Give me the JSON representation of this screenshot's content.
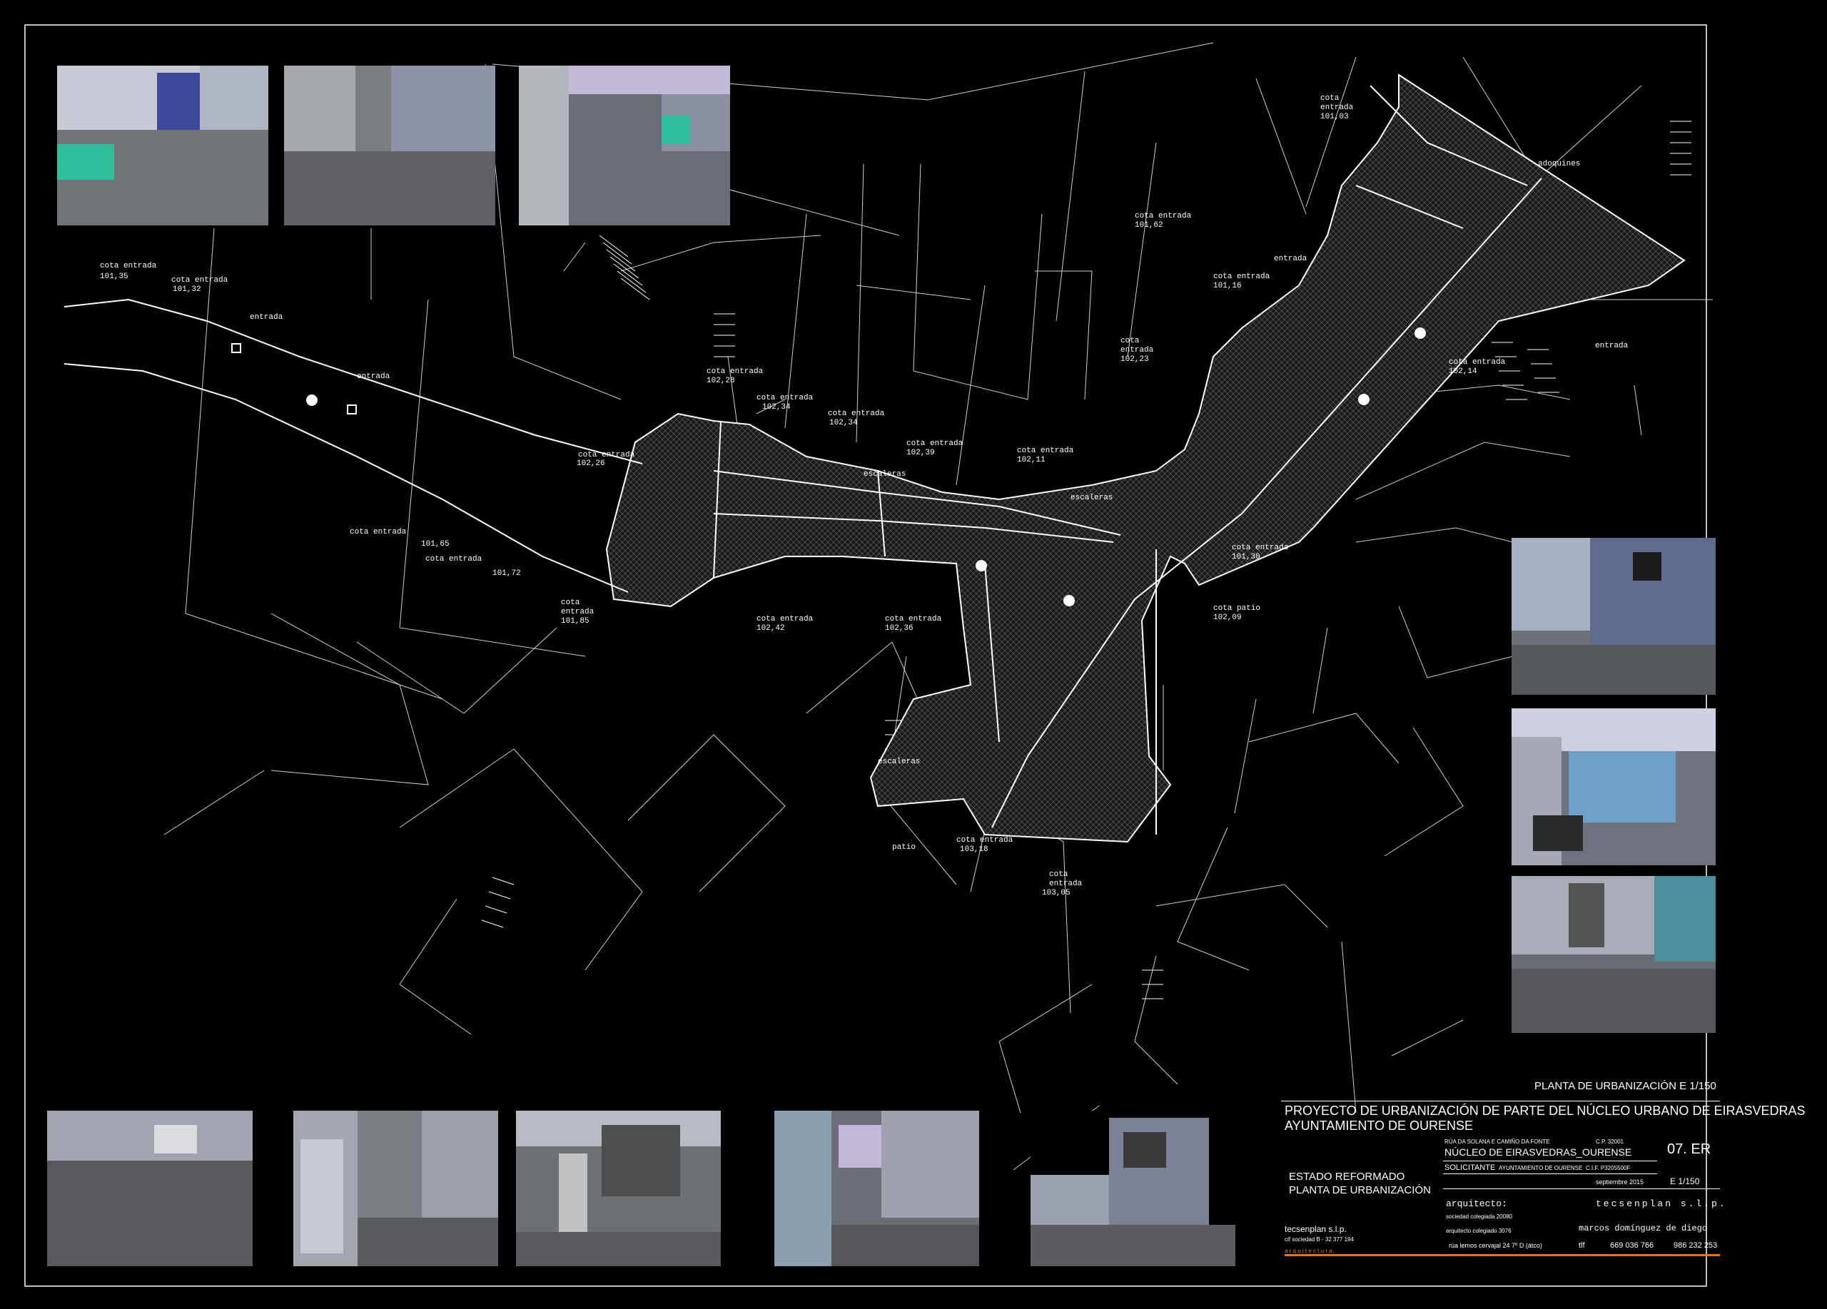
{
  "drawing": {
    "title": "PLANTA DE URBANIZACIÓN E 1/150",
    "labels": {
      "cota_entrada": "cota entrada",
      "entrada": "entrada",
      "escaleras": "escaleras",
      "patio": "patio",
      "cota_patio": "cota patio",
      "adoquines": "adoquines"
    },
    "elevations": {
      "e1": "101,35",
      "e2": "101,32",
      "e3": "102,28",
      "e4": "102,34",
      "e5": "102,34",
      "e6": "102,26",
      "e7": "102,39",
      "e8": "102,11",
      "e9": "101,65",
      "e10": "101,72",
      "e11": "101,85",
      "e12": "102,42",
      "e13": "102,36",
      "e14": "103,18",
      "e15": "103,05",
      "e16": "101,62",
      "e17": "101,16",
      "e18": "102,23",
      "e19": "101,03",
      "e20": "102,14",
      "e21": "101,30",
      "e22": "102,09"
    }
  },
  "title_block": {
    "project_line1": "PROYECTO DE URBANIZACIÓN DE PARTE DEL NÚCLEO URBANO DE EIRASVEDRAS",
    "project_line2": "AYUNTAMIENTO DE OURENSE",
    "street": "RÚA DA SOLANA E CAMIÑO DA FONTE",
    "postal_code": "C.P. 32001",
    "location": "NÚCLEO DE EIRASVEDRAS_OURENSE",
    "sheet": "07. ER",
    "solicitante_label": "SOLICITANTE",
    "solicitante": "AYUNTAMIENTO DE OURENSE",
    "cif": "C.I.F. P3205500F",
    "date": "septiembre 2015",
    "scale": "E 1/150",
    "state_line1": "ESTADO REFORMADO",
    "state_line2": "PLANTA DE URBANIZACIÓN",
    "arquitecto_label": "arquitecto:",
    "firm_spaced": "tecsenplan s.l.p.",
    "colegiado1": "sociedad colegiada 20080",
    "colegiado2": "arquitecto colegiado 3076",
    "architect_name": "marcos domínguez de diego",
    "firm": "tecsenplan s.l.p.",
    "firm_cif": "cif sociedad B - 32 377 194",
    "firm_tag": "a r q u i t e c t u r a",
    "address": "rúa lemos cervajal 24 7º D (átco)",
    "tlf_label": "tlf",
    "phone1": "669 036 766",
    "phone2": "986 232 253"
  },
  "colors": {
    "background": "#000000",
    "lines": "#ffffff",
    "accent": "#e07820"
  }
}
